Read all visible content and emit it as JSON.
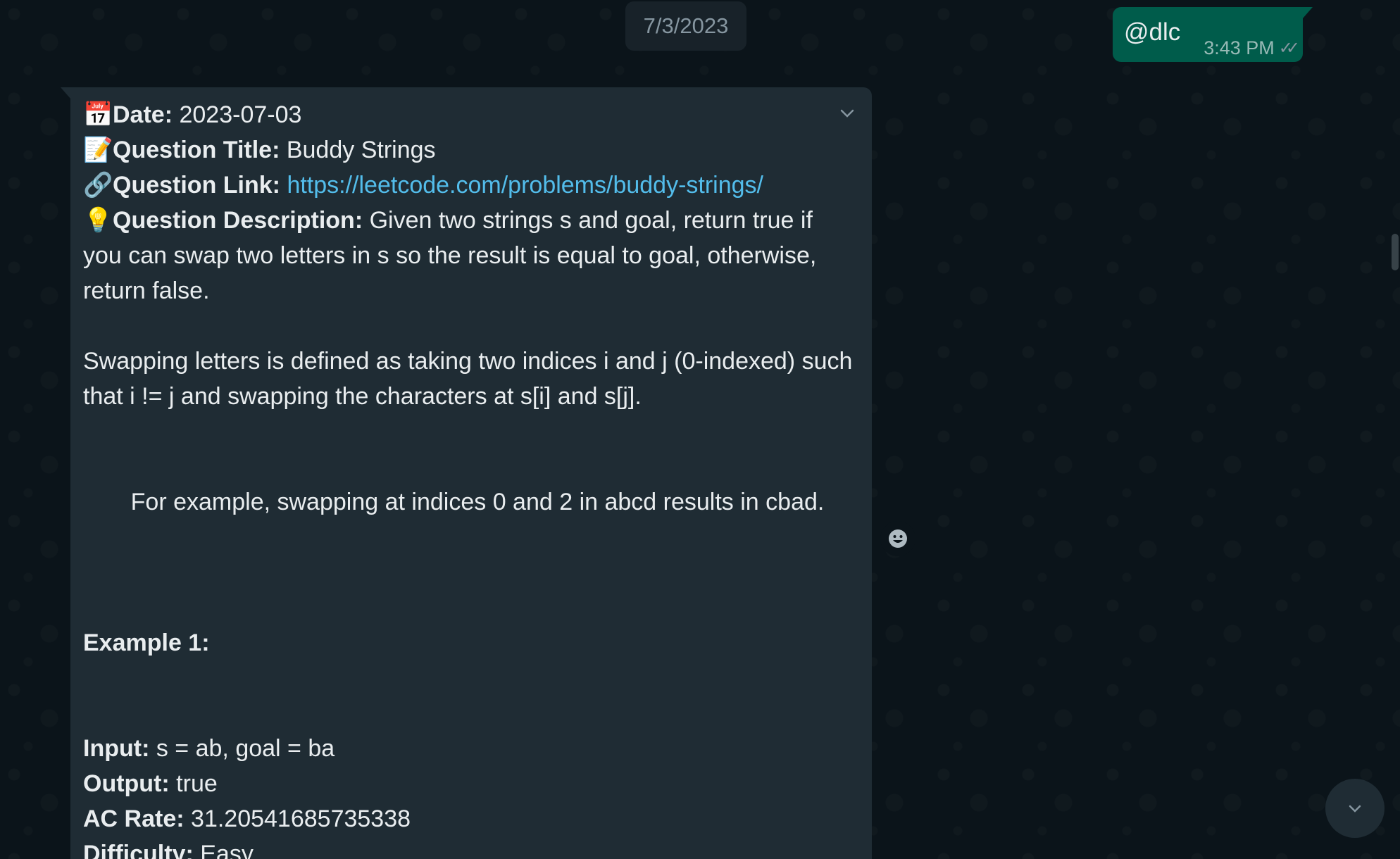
{
  "date_chip": "7/3/2023",
  "outgoing": {
    "text": "@dlc",
    "time": "3:43 PM"
  },
  "message": {
    "date_label": "Date:",
    "date_value": "2023-07-03",
    "title_label": "Question Title:",
    "title_value": "Buddy Strings",
    "link_label": "Question Link:",
    "link_value": "https://leetcode.com/problems/buddy-strings/",
    "desc_label": "Question Description:",
    "desc_value": "Given two strings s and goal, return true if you can swap two letters in s so the result is equal to goal, otherwise, return false.",
    "para2": "Swapping letters is defined as taking two indices i and j (0-indexed) such that i != j and swapping the characters at s[i] and s[j].",
    "example_note": "For example, swapping at indices 0 and 2 in abcd results in cbad.",
    "example_heading": "Example 1:",
    "input_label": "Input:",
    "input_value": "s = ab, goal = ba",
    "output_label": "Output:",
    "output_value": "true",
    "ac_label": "AC Rate:",
    "ac_value": "31.20541685735338",
    "difficulty_label": "Difficulty:",
    "difficulty_value": "Easy"
  },
  "icons": {
    "date": "calendar-icon",
    "title": "memo-icon",
    "link": "link-icon",
    "desc": "lightbulb-icon",
    "menu": "chevron-down-icon",
    "react": "smiley-icon",
    "scroll": "chevron-down-icon"
  },
  "colors": {
    "background": "#0b141a",
    "incoming": "#1f2c34",
    "outgoing": "#005c4b",
    "link": "#53bdeb"
  }
}
